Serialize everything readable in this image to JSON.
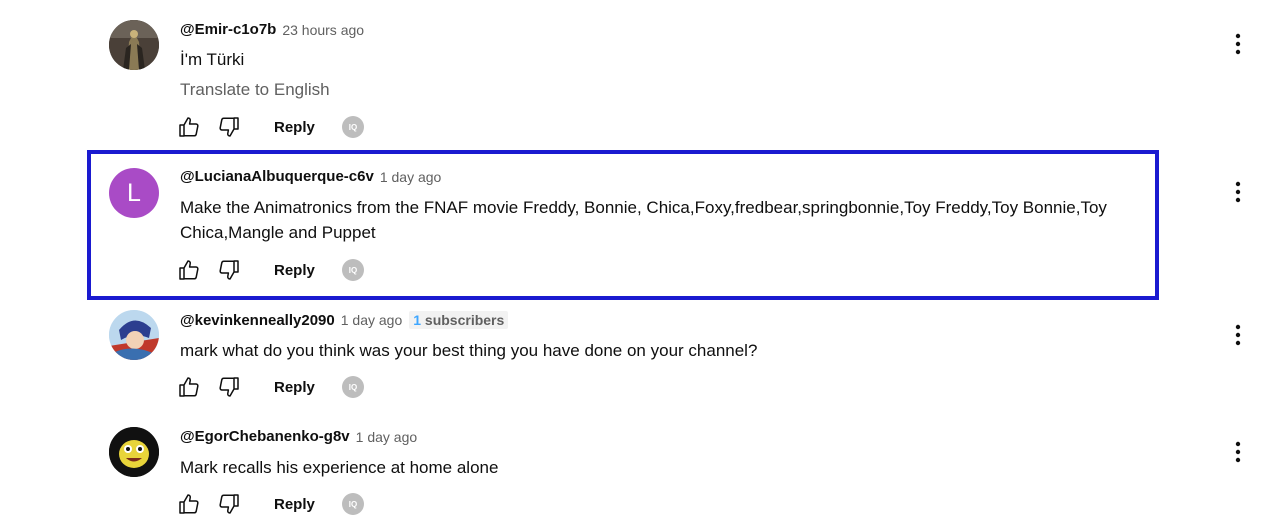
{
  "comments": [
    {
      "author": "@Emir-c1o7b",
      "time": "23 hours ago",
      "text": "İ'm Türki",
      "translate": "Translate to English",
      "reply": "Reply",
      "avatar": "photo"
    },
    {
      "author": "@LucianaAlbuquerque-c6v",
      "time": "1 day ago",
      "text": "Make the Animatronics from the FNAF movie Freddy, Bonnie, Chica,Foxy,fredbear,springbonnie,Toy Freddy,Toy Bonnie,Toy Chica,Mangle and Puppet",
      "reply": "Reply",
      "avatar_letter": "L",
      "avatar_color": "#a94bc6",
      "highlighted": true,
      "highlight_color": "#1a1ad0"
    },
    {
      "author": "@kevinkenneally2090",
      "time": "1 day ago",
      "subs_count": "1",
      "subs_label": "subscribers",
      "text": "mark what do you think was your best thing you have done on your channel?",
      "reply": "Reply",
      "avatar": "photo"
    },
    {
      "author": "@EgorChebanenko-g8v",
      "time": "1 day ago",
      "text": "Mark recalls his experience at home alone",
      "reply": "Reply",
      "avatar": "photo"
    }
  ],
  "icons": {
    "like": "thumb-up-icon",
    "dislike": "thumb-down-icon",
    "iq": "iq-icon",
    "more": "more-vert-icon"
  }
}
